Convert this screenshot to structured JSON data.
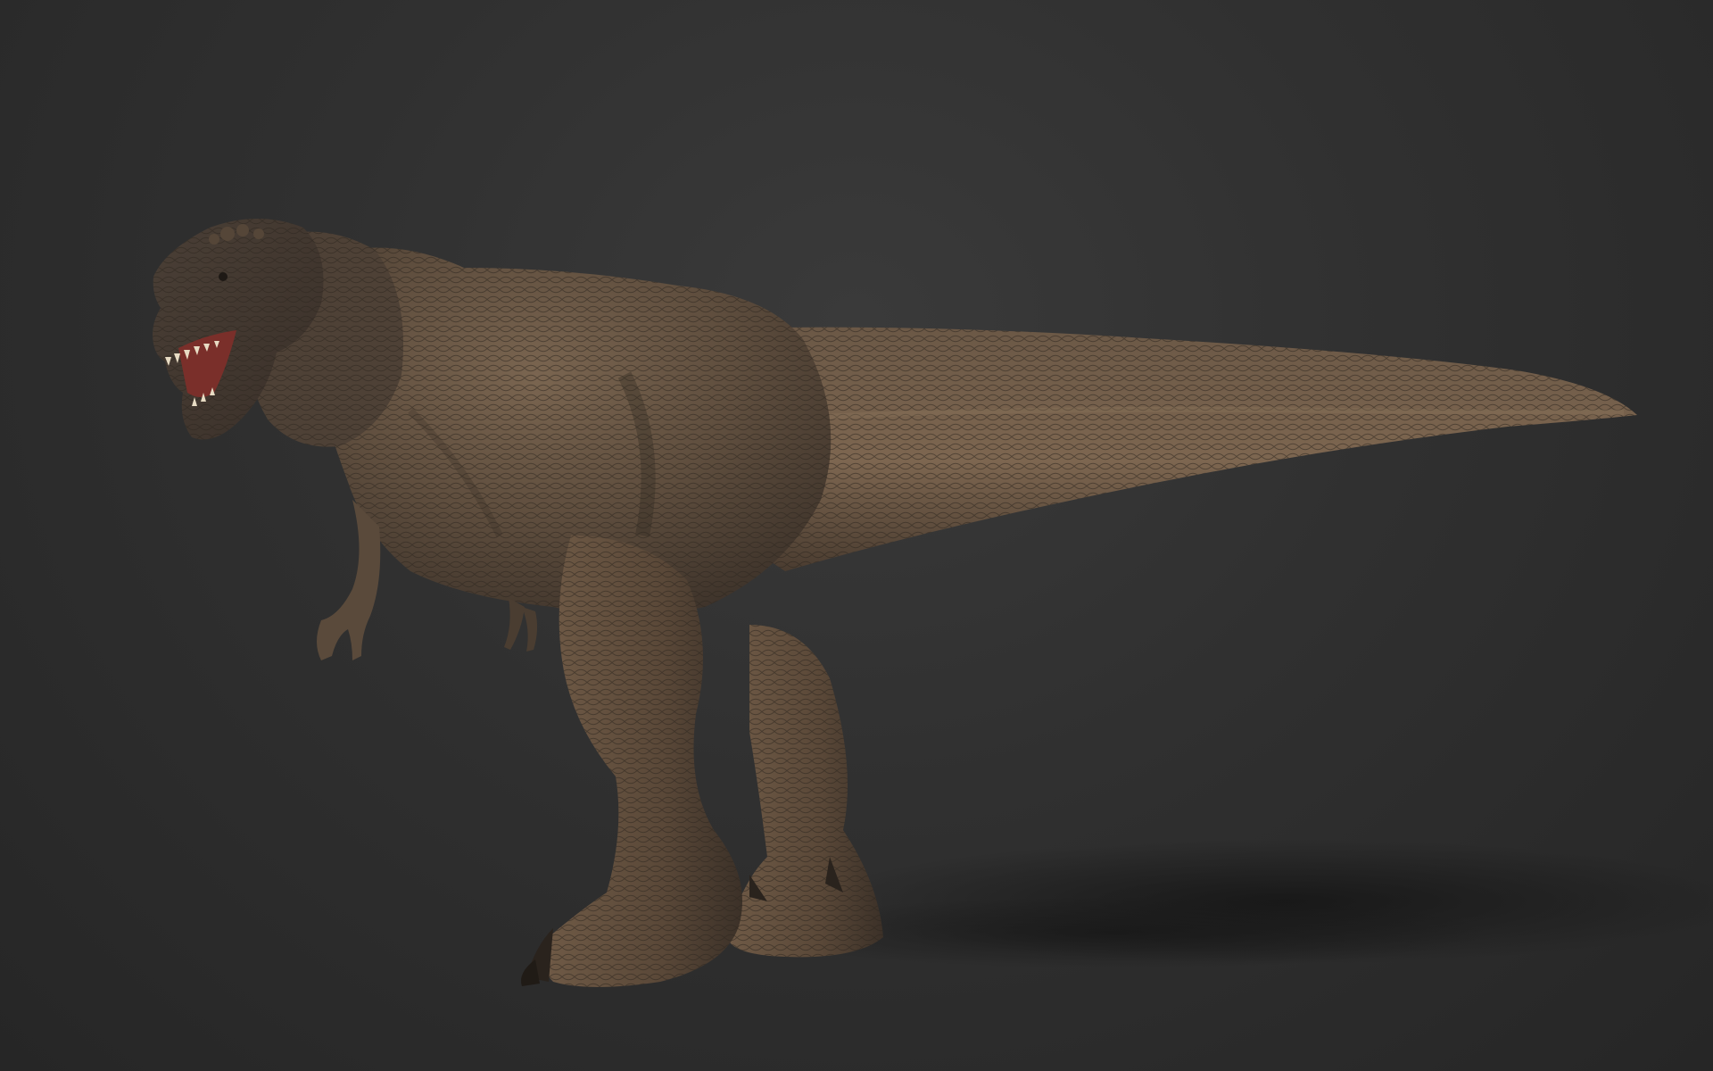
{
  "scene": {
    "subject_icon": "tyrannosaurus-icon",
    "colors": {
      "background_center": "#3a3a3a",
      "background_edge": "#262626",
      "skin_dark": "#3e342b",
      "skin_mid": "#5f4e3e",
      "skin_light": "#8a7258",
      "mouth": "#7a2f2a",
      "teeth": "#e8dcc4",
      "shadow": "#1c1c1c"
    }
  }
}
